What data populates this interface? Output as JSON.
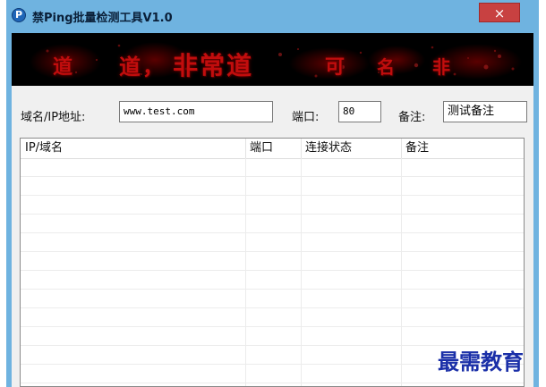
{
  "window": {
    "title": "禁Ping批量检测工具V1.0",
    "icon": "app-logo-icon",
    "close_glyph": "×",
    "colors": {
      "frame": "#6fb3e0",
      "close": "#c84141",
      "client": "#f0f0f0"
    }
  },
  "banner": {
    "segments": [
      "道",
      "道，",
      "非常道",
      "可",
      "名",
      "非"
    ],
    "colors": {
      "background": "#000000",
      "text": "#c10d0d"
    }
  },
  "form": {
    "domain_label": "域名/IP地址:",
    "domain_value": "www.test.com",
    "port_label": "端口:",
    "port_value": "80",
    "remark_label": "备注:",
    "remark_value": "测试备注"
  },
  "table": {
    "columns": [
      "IP/域名",
      "端口",
      "连接状态",
      "备注"
    ],
    "rows": []
  },
  "watermark": {
    "text": "最需教育"
  }
}
